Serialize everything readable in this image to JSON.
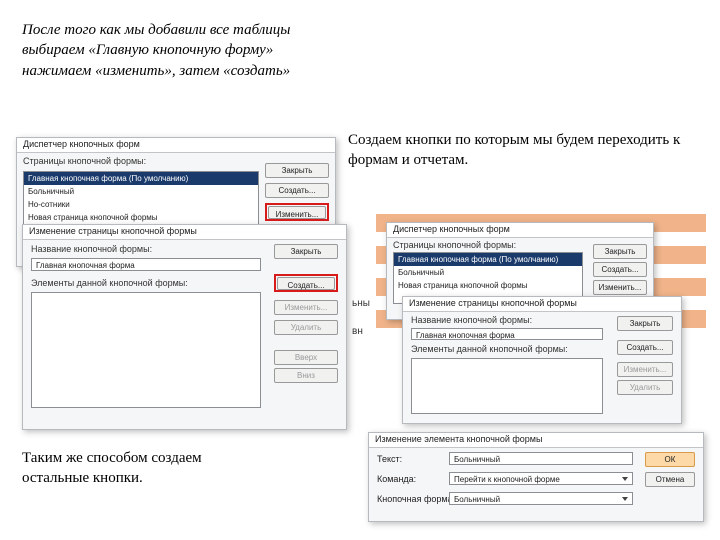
{
  "text": {
    "top_left": "После того как мы добавили все таблицы выбираем «Главную кнопочную форму» нажимаем «изменить», затем «создать»",
    "top_right": "Создаем кнопки по которым мы будем переходить к формам и отчетам.",
    "bottom_left": "Таким же способом создаем остальные кнопки."
  },
  "d1": {
    "title": "Диспетчер кнопочных форм",
    "list_label": "Страницы кнопочной формы:",
    "items": [
      "Главная кнопочная форма (По умолчанию)",
      "Больничный",
      "Но-сотники",
      "Новая страница кнопочной формы"
    ],
    "btn_close": "Закрыть",
    "btn_new": "Создать...",
    "btn_edit": "Изменить..."
  },
  "d2": {
    "title": "Изменение страницы кнопочной формы",
    "name_label": "Название кнопочной формы:",
    "name_value": "Главная кнопочная форма",
    "items_label": "Элементы данной кнопочной формы:",
    "btn_close": "Закрыть",
    "btn_new": "Создать...",
    "btn_edit": "Изменить...",
    "btn_delete": "Удалить",
    "btn_up": "Вверх",
    "btn_down": "Вниз"
  },
  "side": {
    "lbl1": "ьны",
    "lbl2": "вн"
  },
  "d3": {
    "title": "Диспетчер кнопочных форм",
    "list_label": "Страницы кнопочной формы:",
    "items": [
      "Главная кнопочная форма (По умолчанию)",
      "Больничный",
      "Новая страница кнопочной формы"
    ],
    "btn_close": "Закрыть",
    "btn_new": "Создать...",
    "btn_edit": "Изменить..."
  },
  "d4": {
    "title": "Изменение страницы кнопочной формы",
    "name_label": "Название кнопочной формы:",
    "name_value": "Главная кнопочная форма",
    "items_label": "Элементы данной кнопочной формы:",
    "btn_close": "Закрыть",
    "btn_new": "Создать...",
    "btn_edit": "Изменить...",
    "btn_delete": "Удалить"
  },
  "d5": {
    "title": "Изменение элемента кнопочной формы",
    "row1_label": "Текст:",
    "row1_value": "Больничный",
    "row2_label": "Команда:",
    "row2_value": "Перейти к кнопочной форме",
    "row3_label": "Кнопочная форма:",
    "row3_value": "Больничный",
    "btn_ok": "ОК",
    "btn_cancel": "Отмена"
  }
}
